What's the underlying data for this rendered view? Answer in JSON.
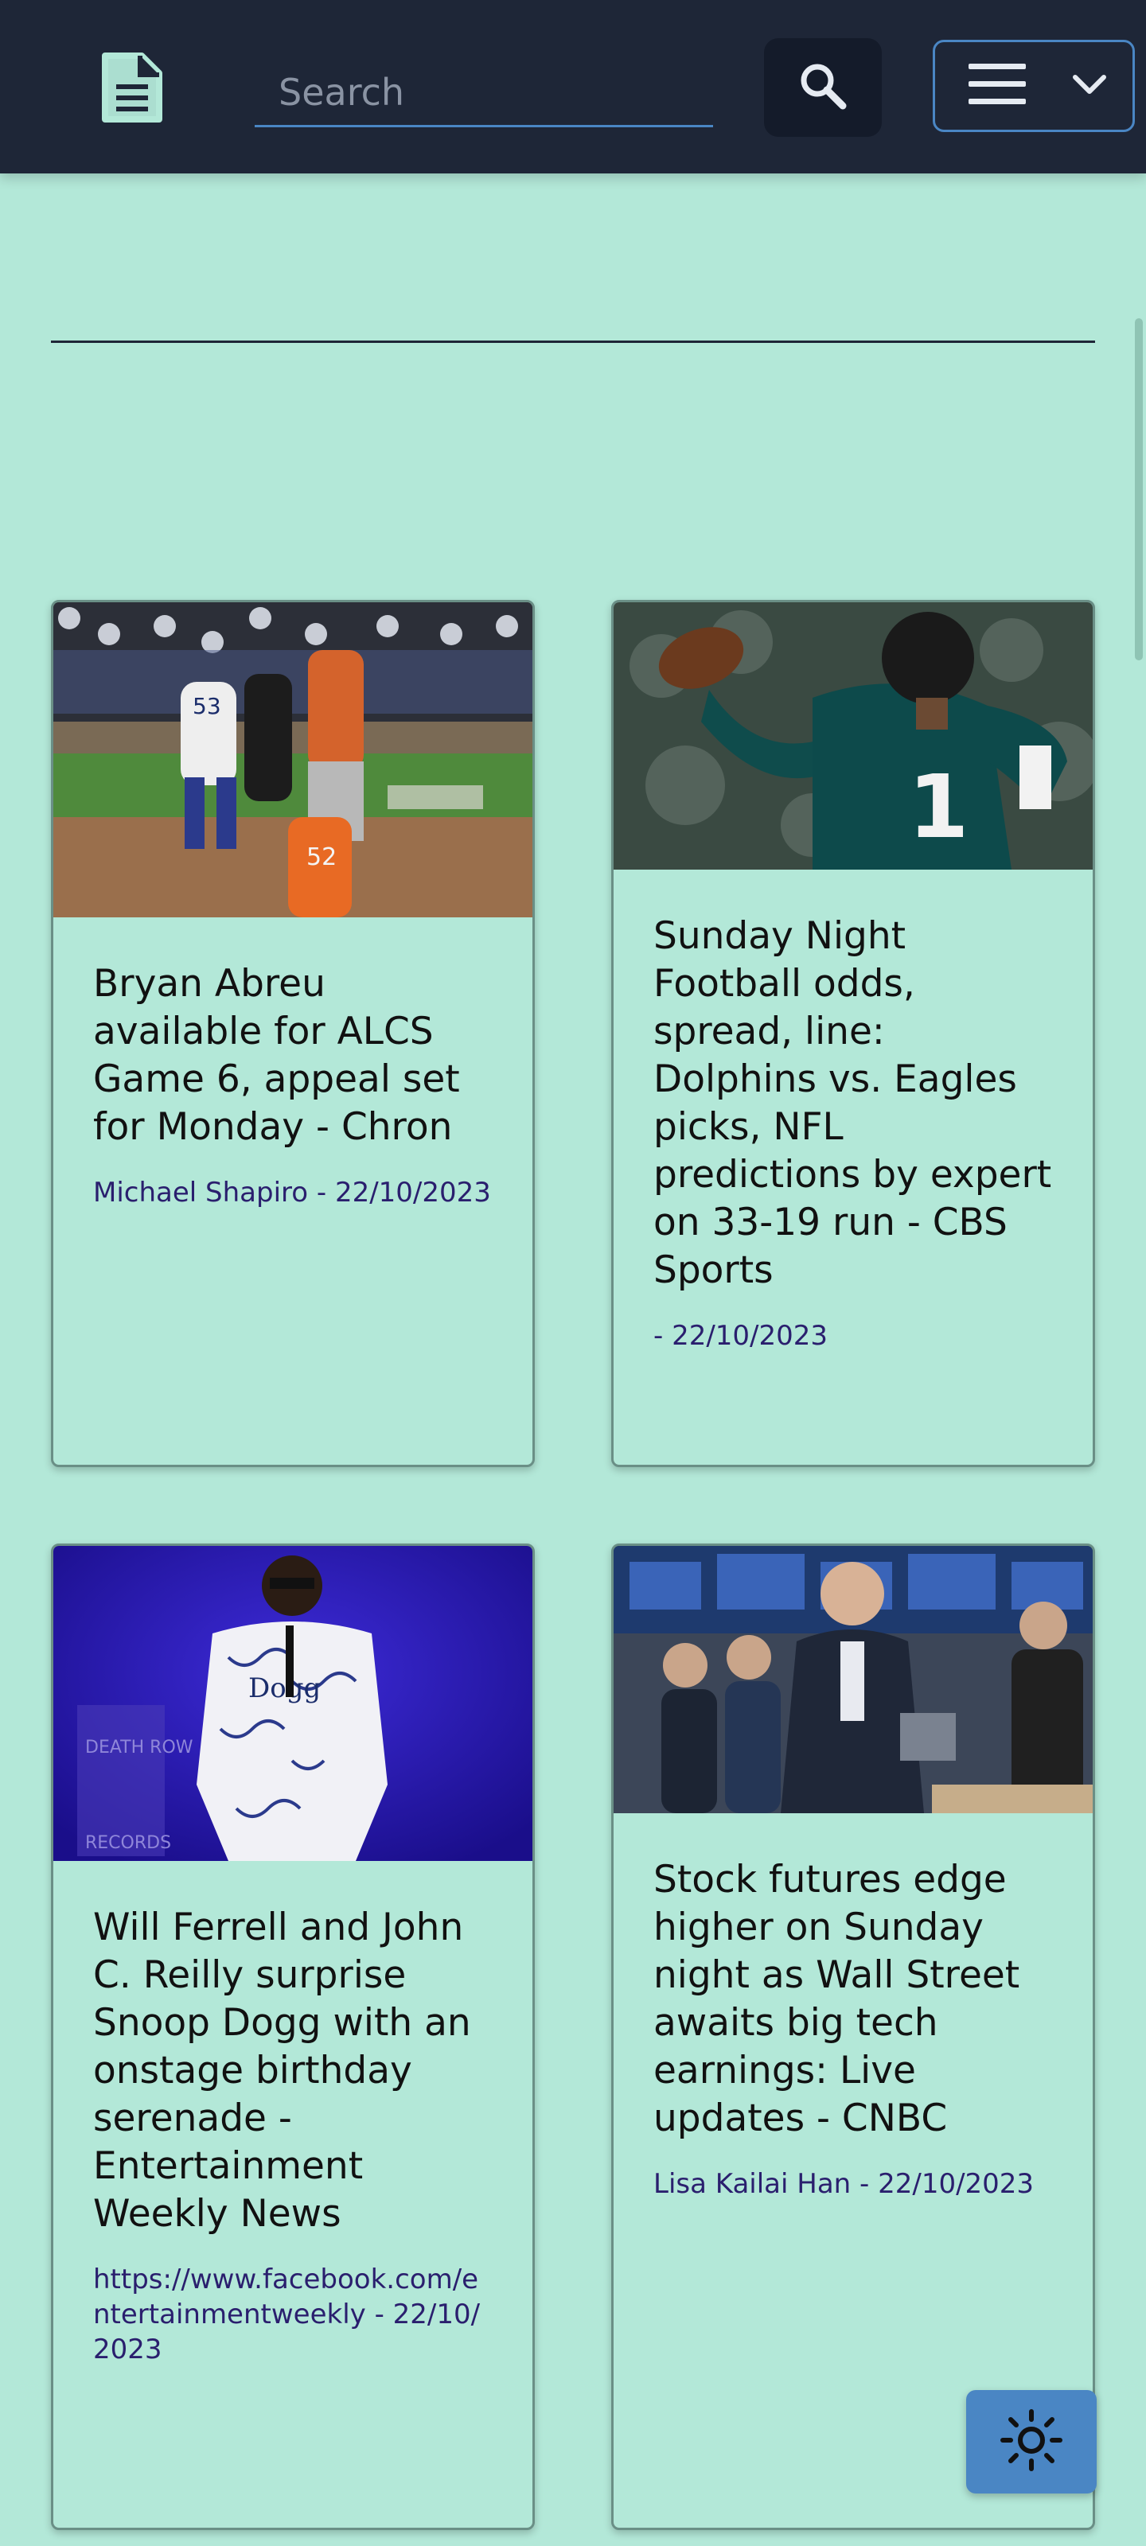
{
  "header": {
    "search_placeholder": "Search"
  },
  "articles": [
    {
      "title": "Bryan Abreu available for ALCS Game 6, appeal set for Monday - Chron",
      "meta": "Michael Shapiro - 22/10/2023",
      "image": "baseball-players-photo"
    },
    {
      "title": "Sunday Night Football odds, spread, line: Dolphins vs. Eagles picks, NFL predictions by expert on 33-19 run - CBS Sports",
      "meta": "- 22/10/2023",
      "image": "football-quarterback-photo"
    },
    {
      "title": "Will Ferrell and John C. Reilly surprise Snoop Dogg with an onstage birthday serenade - Entertainment Weekly News",
      "meta": "https://www.facebook.com/entertainmentweekly - 22/10/2023",
      "image": "concert-performer-photo"
    },
    {
      "title": "Stock futures edge higher on Sunday night as Wall Street awaits big tech earnings: Live updates - CNBC",
      "meta": "Lisa Kailai Han - 22/10/2023",
      "image": "stock-exchange-traders-photo"
    }
  ],
  "colors": {
    "header_bg": "#1e2637",
    "page_bg": "#b3e8d8",
    "accent": "#4a86c4",
    "meta_text": "#2a1f6e"
  },
  "icons": [
    "document-icon",
    "search-icon",
    "hamburger-icon",
    "chevron-down-icon",
    "sun-icon"
  ]
}
